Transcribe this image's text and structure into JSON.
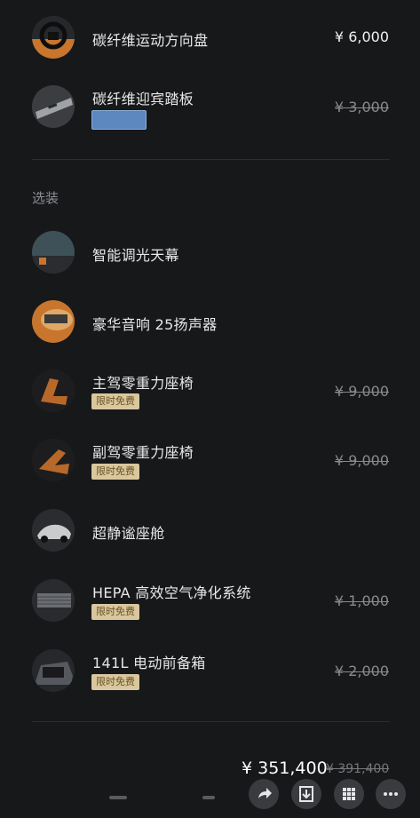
{
  "items": [
    {
      "name": "碳纤维运动方向盘",
      "price": "¥ 6,000",
      "price_strike": false,
      "thumb": "steering-wheel"
    },
    {
      "name": "碳纤维迎宾踏板",
      "price": "¥ 3,000",
      "price_strike": true,
      "thumb": "welcome-pedal",
      "swatch_color": "#5c87bf"
    }
  ],
  "options_section": {
    "title": "选装",
    "items": [
      {
        "name": "智能调光天幕",
        "price": "",
        "badge": "",
        "thumb": "glass-roof"
      },
      {
        "name": "豪华音响 25扬声器",
        "price": "",
        "badge": "",
        "thumb": "speaker"
      },
      {
        "name": "主驾零重力座椅",
        "price": "¥ 9,000",
        "badge": "限时免费",
        "thumb": "seat"
      },
      {
        "name": "副驾零重力座椅",
        "price": "¥ 9,000",
        "badge": "限时免费",
        "thumb": "seat"
      },
      {
        "name": "超静谧座舱",
        "price": "",
        "badge": "",
        "thumb": "car"
      },
      {
        "name": "HEPA 高效空气净化系统",
        "price": "¥ 1,000",
        "badge": "限时免费",
        "thumb": "filter"
      },
      {
        "name": "141L 电动前备箱",
        "price": "¥ 2,000",
        "badge": "限时免费",
        "thumb": "frunk"
      }
    ]
  },
  "total": {
    "price": "¥ 351,400",
    "original": "¥ 391,400"
  },
  "fab_icons": [
    "share-icon",
    "download-icon",
    "grid-icon",
    "more-icon"
  ],
  "colors": {
    "background": "#17181a",
    "badge_bg": "#d9c79d",
    "badge_text": "#6b5326",
    "accent_orange": "#c8752d"
  }
}
